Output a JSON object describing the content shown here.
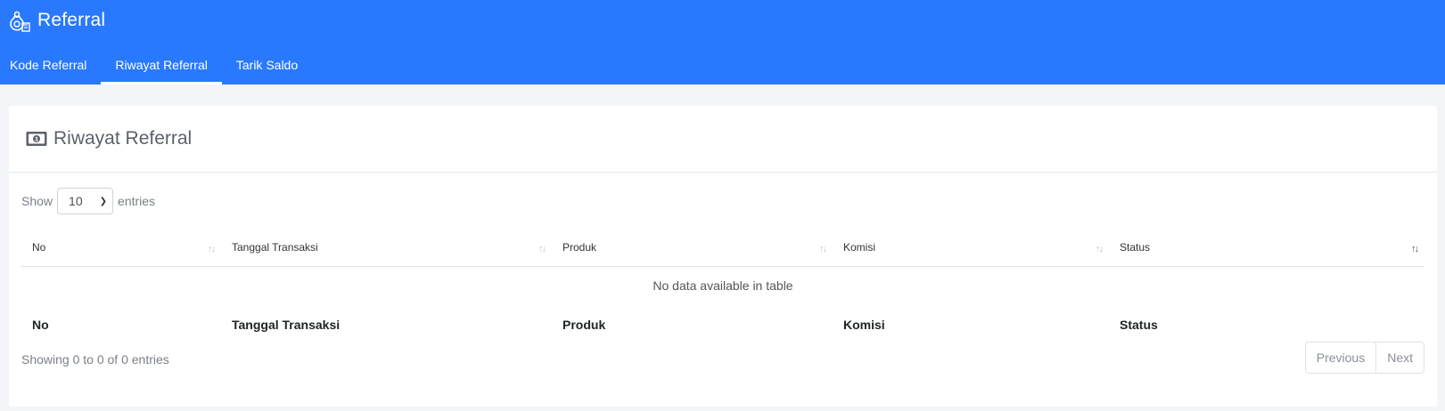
{
  "app": {
    "title": "Referral"
  },
  "tabs": [
    {
      "label": "Kode Referral",
      "active": false
    },
    {
      "label": "Riwayat Referral",
      "active": true
    },
    {
      "label": "Tarik Saldo",
      "active": false
    }
  ],
  "card": {
    "title": "Riwayat Referral"
  },
  "length": {
    "show_label": "Show",
    "value": "10",
    "entries_label": "entries"
  },
  "table": {
    "columns": [
      "No",
      "Tanggal Transaksi",
      "Produk",
      "Komisi",
      "Status"
    ],
    "empty_message": "No data available in table",
    "footer_columns": [
      "No",
      "Tanggal Transaksi",
      "Produk",
      "Komisi",
      "Status"
    ]
  },
  "info": "Showing 0 to 0 of 0 entries",
  "pagination": {
    "previous": "Previous",
    "next": "Next"
  },
  "colors": {
    "primary": "#2979ff"
  }
}
